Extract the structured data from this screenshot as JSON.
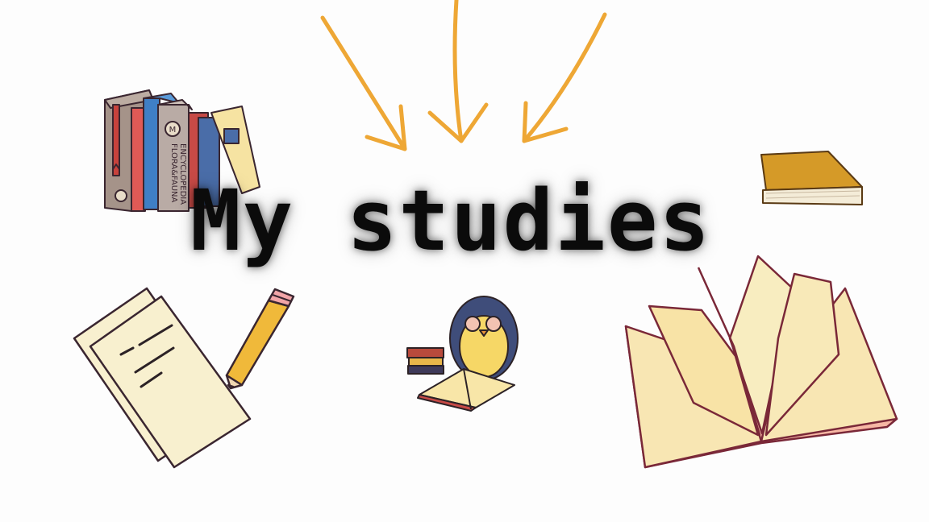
{
  "title": "My studies",
  "book_spines": {
    "flora_line1": "FLORA&FAUNA",
    "flora_line2": "ENCYCLOPEDIA",
    "flora_monogram": "M"
  },
  "illustrations": [
    "arrows-icon",
    "bookshelf-icon",
    "closed-book-icon",
    "paper-pencil-icon",
    "penguin-reading-icon",
    "open-book-icon"
  ],
  "colors": {
    "background": "#fdfdfd",
    "title": "#0b0b0b",
    "arrows": "#eea735",
    "paper": "#f8f0cf",
    "outline": "#3a2630"
  }
}
